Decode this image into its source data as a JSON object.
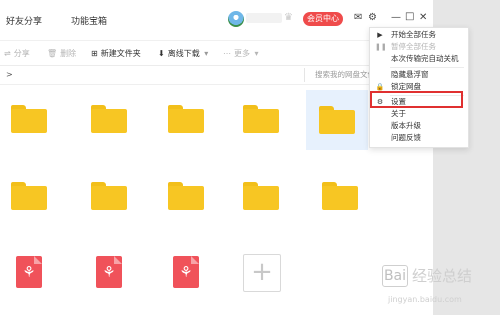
{
  "header": {
    "tabs": [
      {
        "label": "好友分享"
      },
      {
        "label": "功能宝箱"
      }
    ],
    "vip_button": "会员中心",
    "icons": {
      "mail": "mail-icon",
      "settings": "gear-icon",
      "minimize": "minimize-icon",
      "maximize": "maximize-icon",
      "close": "close-icon"
    }
  },
  "toolbar": {
    "share": "分享",
    "delete": "删除",
    "new_folder": "新建文件夹",
    "offline_download": "离线下载",
    "more": "更多"
  },
  "path": {
    "arrow": ">",
    "search_placeholder": "搜索我的网盘文件"
  },
  "files": {
    "row1": [
      "folder",
      "folder",
      "folder",
      "folder",
      "folder"
    ],
    "row2": [
      "folder",
      "folder",
      "folder",
      "folder",
      "folder"
    ],
    "row3": [
      "pdf",
      "pdf",
      "pdf",
      "add"
    ],
    "add_glyph": "+"
  },
  "menu": {
    "items": [
      {
        "label": "开始全部任务",
        "icon": "play-icon",
        "disabled": false
      },
      {
        "label": "暂停全部任务",
        "icon": "pause-icon",
        "disabled": true
      },
      {
        "label": "本次传输完自动关机",
        "icon": "",
        "disabled": false
      },
      {
        "label": "隐藏悬浮窗",
        "icon": "",
        "disabled": false
      },
      {
        "label": "锁定网盘",
        "icon": "lock-icon",
        "disabled": false
      },
      {
        "label": "设置",
        "icon": "gear-icon",
        "disabled": false
      },
      {
        "label": "关于",
        "icon": "",
        "disabled": false
      },
      {
        "label": "版本升级",
        "icon": "",
        "disabled": false
      },
      {
        "label": "问题反馈",
        "icon": "",
        "disabled": false
      }
    ],
    "highlighted": "设置"
  },
  "watermark": {
    "title": "经验总结",
    "subtitle": "jingyan.baidu.com"
  },
  "colors": {
    "vip_red": "#ef4b4b",
    "folder_yellow": "#f7c623",
    "pdf_red": "#f0525a",
    "selection_blue": "#e7f1fd",
    "highlight_red": "#e03030"
  }
}
